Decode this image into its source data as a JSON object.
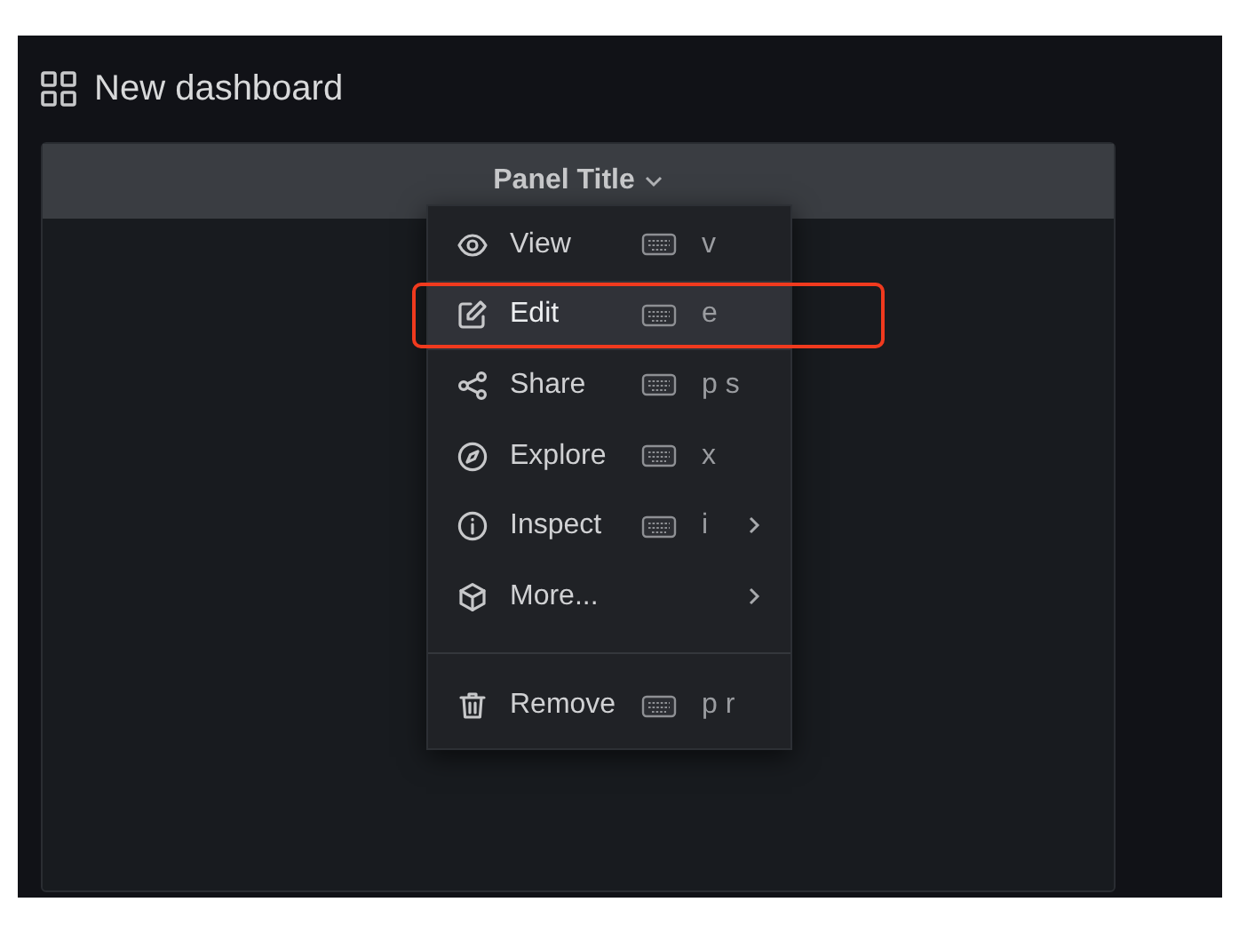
{
  "dashboard": {
    "title": "New dashboard"
  },
  "panel": {
    "title": "Panel Title"
  },
  "menu": [
    {
      "kind": "action",
      "label": "View",
      "shortcut": "v",
      "submenu": false,
      "selected": false,
      "annotated": false
    },
    {
      "kind": "action",
      "label": "Edit",
      "shortcut": "e",
      "submenu": false,
      "selected": true,
      "annotated": true
    },
    {
      "kind": "action",
      "label": "Share",
      "shortcut": "p s",
      "submenu": false,
      "selected": false,
      "annotated": false
    },
    {
      "kind": "action",
      "label": "Explore",
      "shortcut": "x",
      "submenu": false,
      "selected": false,
      "annotated": false
    },
    {
      "kind": "action",
      "label": "Inspect",
      "shortcut": "i",
      "submenu": true,
      "selected": false,
      "annotated": false
    },
    {
      "kind": "action",
      "label": "More...",
      "submenu": true,
      "selected": false,
      "annotated": false
    },
    {
      "kind": "divider"
    },
    {
      "kind": "action",
      "label": "Remove",
      "shortcut": "p r",
      "submenu": false,
      "selected": false,
      "annotated": false
    }
  ]
}
